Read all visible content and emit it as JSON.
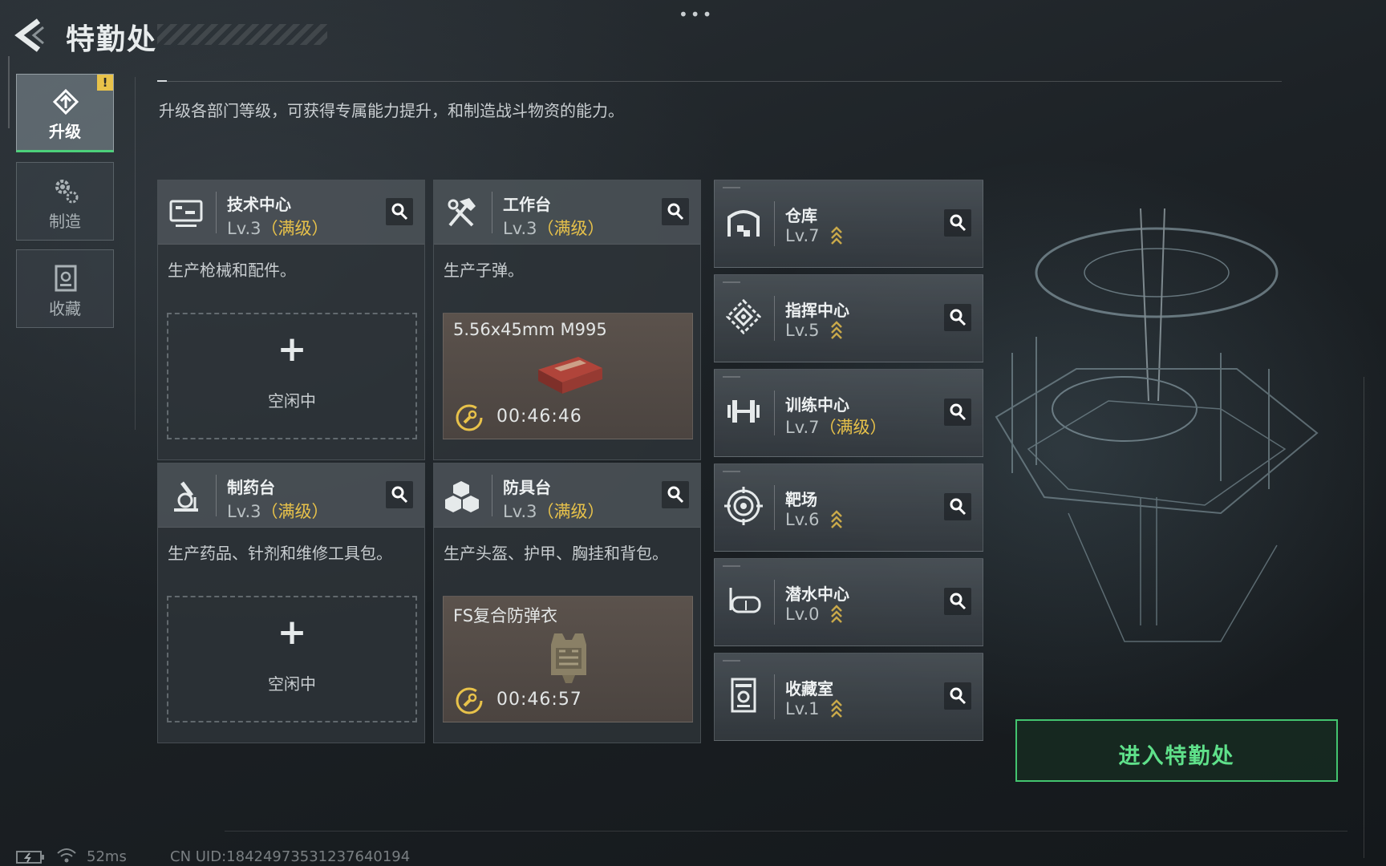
{
  "header": {
    "title": "特勤处",
    "more_label": "•••"
  },
  "tabs": [
    {
      "label": "升级",
      "icon": "upgrade-icon",
      "active": true,
      "badge": "!"
    },
    {
      "label": "制造",
      "icon": "gear-icon",
      "active": false
    },
    {
      "label": "收藏",
      "icon": "collection-icon",
      "active": false
    }
  ],
  "description": "升级各部门等级，可获得专属能力提升，和制造战斗物资的能力。",
  "cards": [
    {
      "name": "技术中心",
      "level": "Lv.3",
      "status": "（满级）",
      "desc": "生产枪械和配件。",
      "icon": "computer-icon",
      "slot": {
        "state": "idle",
        "plus": "+",
        "label": "空闲中"
      }
    },
    {
      "name": "工作台",
      "level": "Lv.3",
      "status": "（满级）",
      "desc": "生产子弹。",
      "icon": "hammer-wrench-icon",
      "slot": {
        "state": "crafting",
        "item": "5.56x45mm M995",
        "timer": "00:46:46",
        "item_icon": "ammo-box-icon"
      }
    },
    {
      "name": "制药台",
      "level": "Lv.3",
      "status": "（满级）",
      "desc": "生产药品、针剂和维修工具包。",
      "icon": "microscope-icon",
      "slot": {
        "state": "idle",
        "plus": "+",
        "label": "空闲中"
      }
    },
    {
      "name": "防具台",
      "level": "Lv.3",
      "status": "（满级）",
      "desc": "生产头盔、护甲、胸挂和背包。",
      "icon": "armor-blocks-icon",
      "slot": {
        "state": "crafting",
        "item": "FS复合防弹衣",
        "timer": "00:46:57",
        "item_icon": "body-armor-icon"
      }
    }
  ],
  "facilities": [
    {
      "name": "仓库",
      "level": "Lv.7",
      "status": "",
      "icon": "warehouse-icon"
    },
    {
      "name": "指挥中心",
      "level": "Lv.5",
      "status": "",
      "icon": "command-center-icon"
    },
    {
      "name": "训练中心",
      "level": "Lv.7",
      "status": "（满级）",
      "icon": "dumbbell-icon"
    },
    {
      "name": "靶场",
      "level": "Lv.6",
      "status": "",
      "icon": "target-icon"
    },
    {
      "name": "潜水中心",
      "level": "Lv.0",
      "status": "",
      "icon": "diving-mask-icon"
    },
    {
      "name": "收藏室",
      "level": "Lv.1",
      "status": "",
      "icon": "collection-room-icon"
    }
  ],
  "enter_button": "进入特勤处",
  "footer": {
    "ping": "52ms",
    "uid": "CN UID:18424973531237640194"
  },
  "colors": {
    "accent_green": "#43c46f",
    "max_level_gold": "#e8c24a"
  }
}
